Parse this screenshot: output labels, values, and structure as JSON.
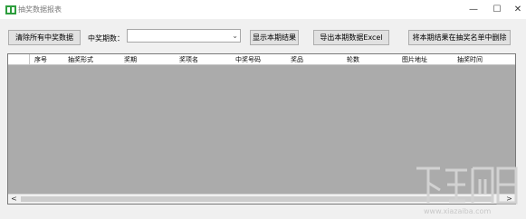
{
  "window": {
    "title": "抽奖数据报表",
    "controls": {
      "minimize": "—",
      "maximize": "☐",
      "close": "✕"
    }
  },
  "toolbar": {
    "clear_button": "清除所有中奖数据",
    "period_label": "中奖期数：",
    "period_value": "",
    "show_button": "显示本期结果",
    "export_button": "导出本期数据Excel",
    "remove_button": "将本期结果在抽奖名单中删除"
  },
  "grid": {
    "columns": [
      "序号",
      "抽奖形式",
      "奖期",
      "奖项名",
      "中奖号码",
      "奖品",
      "轮数",
      "图片地址",
      "抽奖时间"
    ],
    "rows": []
  },
  "scrollbar": {
    "left": "<",
    "right": ">"
  },
  "watermark": {
    "url": "www.xiazaiba.com"
  },
  "colors": {
    "grid_background": "#ababab",
    "window_background": "#f0f0f0",
    "icon": "#2e9e3e"
  }
}
